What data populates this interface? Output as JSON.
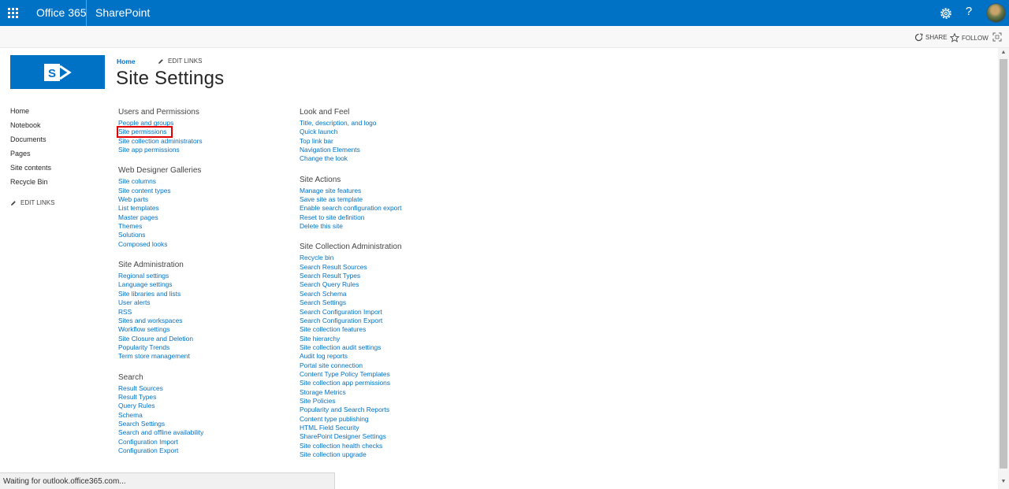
{
  "suitebar": {
    "app_name": "Office 365",
    "product_name": "SharePoint",
    "help_label": "?"
  },
  "ribbon": {
    "share_label": "SHARE",
    "follow_label": "FOLLOW"
  },
  "header": {
    "breadcrumb_home": "Home",
    "edit_links_label": "EDIT LINKS",
    "title": "Site Settings"
  },
  "leftnav": {
    "items": [
      {
        "label": "Home"
      },
      {
        "label": "Notebook"
      },
      {
        "label": "Documents"
      },
      {
        "label": "Pages"
      },
      {
        "label": "Site contents"
      },
      {
        "label": "Recycle Bin"
      }
    ],
    "edit_links_label": "EDIT LINKS"
  },
  "column1": [
    {
      "heading": "Users and Permissions",
      "links": [
        "People and groups",
        "Site permissions",
        "Site collection administrators",
        "Site app permissions"
      ]
    },
    {
      "heading": "Web Designer Galleries",
      "links": [
        "Site columns",
        "Site content types",
        "Web parts",
        "List templates",
        "Master pages",
        "Themes",
        "Solutions",
        "Composed looks"
      ]
    },
    {
      "heading": "Site Administration",
      "links": [
        "Regional settings",
        "Language settings",
        "Site libraries and lists",
        "User alerts",
        "RSS",
        "Sites and workspaces",
        "Workflow settings",
        "Site Closure and Deletion",
        "Popularity Trends",
        "Term store management"
      ]
    },
    {
      "heading": "Search",
      "links": [
        "Result Sources",
        "Result Types",
        "Query Rules",
        "Schema",
        "Search Settings",
        "Search and offline availability",
        "Configuration Import",
        "Configuration Export"
      ]
    }
  ],
  "column2": [
    {
      "heading": "Look and Feel",
      "links": [
        "Title, description, and logo",
        "Quick launch",
        "Top link bar",
        "Navigation Elements",
        "Change the look"
      ]
    },
    {
      "heading": "Site Actions",
      "links": [
        "Manage site features",
        "Save site as template",
        "Enable search configuration export",
        "Reset to site definition",
        "Delete this site"
      ]
    },
    {
      "heading": "Site Collection Administration",
      "links": [
        "Recycle bin",
        "Search Result Sources",
        "Search Result Types",
        "Search Query Rules",
        "Search Schema",
        "Search Settings",
        "Search Configuration Import",
        "Search Configuration Export",
        "Site collection features",
        "Site hierarchy",
        "Site collection audit settings",
        "Audit log reports",
        "Portal site connection",
        "Content Type Policy Templates",
        "Site collection app permissions",
        "Storage Metrics",
        "Site Policies",
        "Popularity and Search Reports",
        "Content type publishing",
        "HTML Field Security",
        "SharePoint Designer Settings",
        "Site collection health checks",
        "Site collection upgrade"
      ]
    }
  ],
  "status": {
    "text": "Waiting for outlook.office365.com..."
  },
  "colors": {
    "suitebar": "#0072c6",
    "link": "#0072c6",
    "highlight_box": "#e00000"
  }
}
